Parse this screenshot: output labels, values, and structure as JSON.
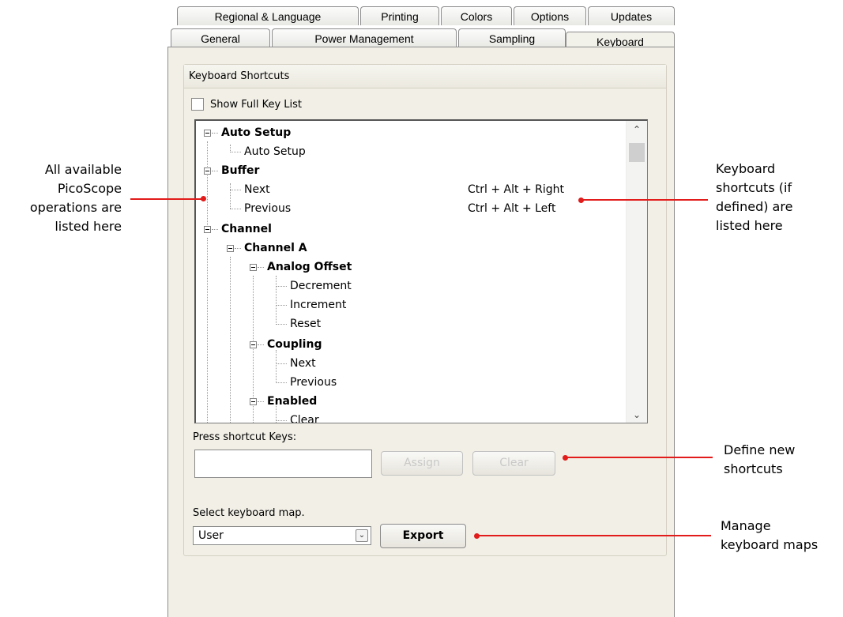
{
  "tabs_back": [
    "Regional & Language",
    "Printing",
    "Colors",
    "Options",
    "Updates"
  ],
  "tabs_front": [
    "General",
    "Power Management",
    "Sampling",
    "Keyboard"
  ],
  "group_title": "Keyboard Shortcuts",
  "show_full_key_list": {
    "label": "Show Full Key List",
    "checked": false
  },
  "tree": {
    "auto_setup": "Auto Setup",
    "auto_setup_child": "Auto Setup",
    "buffer": "Buffer",
    "buffer_next": "Next",
    "buffer_previous": "Previous",
    "channel": "Channel",
    "channel_a": "Channel A",
    "analog_offset": "Analog Offset",
    "decrement": "Decrement",
    "increment": "Increment",
    "reset": "Reset",
    "coupling": "Coupling",
    "coupling_next": "Next",
    "coupling_previous": "Previous",
    "enabled": "Enabled",
    "enabled_clear": "Clear"
  },
  "shortcuts": {
    "buffer_next": "Ctrl + Alt + Right",
    "buffer_previous": "Ctrl + Alt + Left"
  },
  "press_keys": {
    "label": "Press shortcut Keys:",
    "value": ""
  },
  "buttons": {
    "assign": "Assign",
    "clear": "Clear",
    "export": "Export"
  },
  "keyboard_map": {
    "label": "Select keyboard map.",
    "selected": "User"
  },
  "annotations": {
    "left_1": "All available",
    "left_2": "PicoScope",
    "left_3": "operations are",
    "left_4": "listed here",
    "right_1a": "Keyboard",
    "right_1b": "shortcuts (if",
    "right_1c": "defined) are",
    "right_1d": "listed here",
    "right_2a": "Define new",
    "right_2b": "shortcuts",
    "right_3a": "Manage",
    "right_3b": "keyboard maps"
  },
  "colors": {
    "annotation_red": "#e21b1b",
    "panel_bg": "#f1efe6"
  }
}
